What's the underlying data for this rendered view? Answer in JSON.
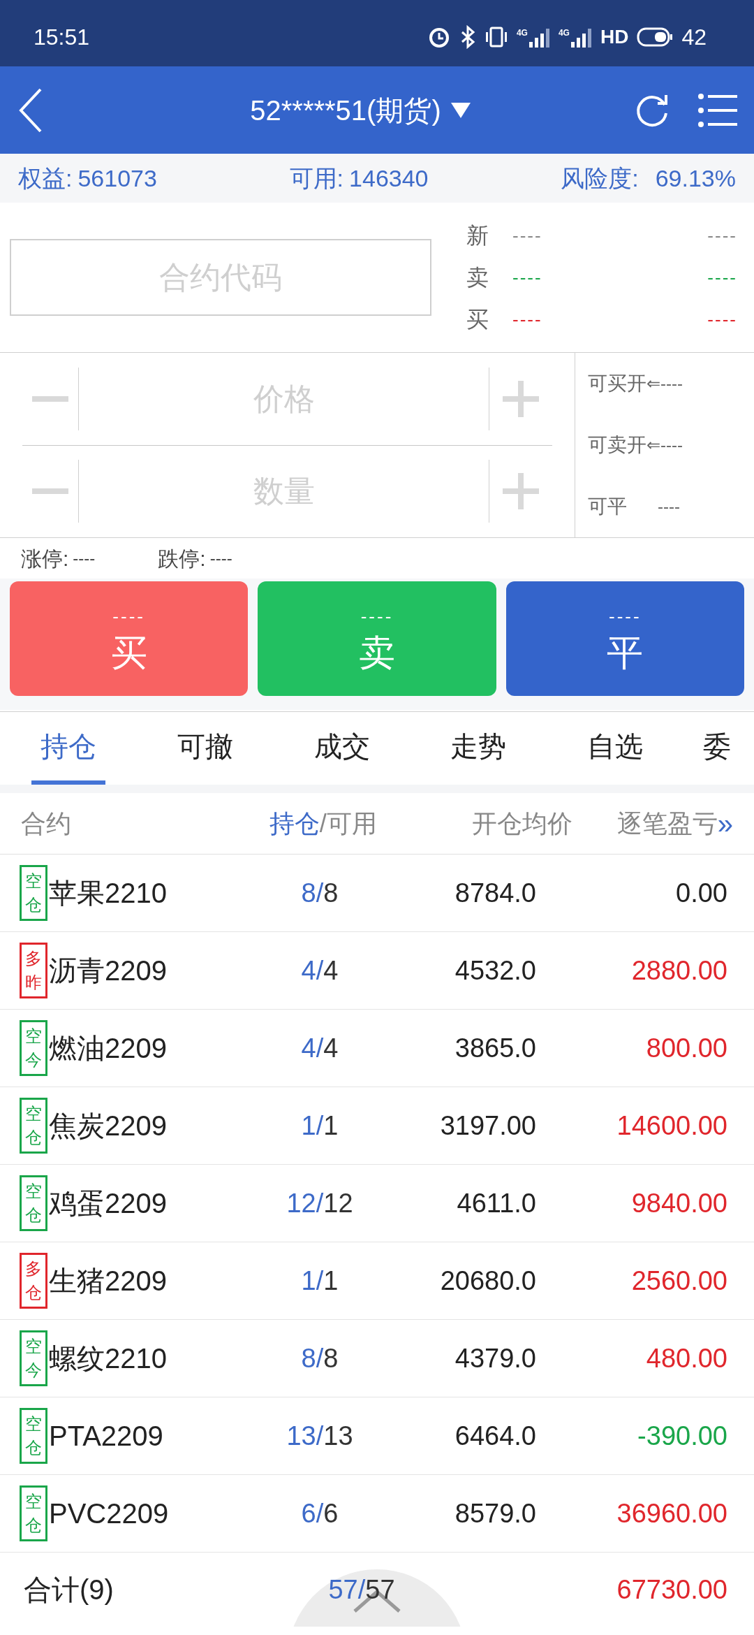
{
  "status_bar": {
    "time": "15:51",
    "network_labels": [
      "4G",
      "4G"
    ],
    "hd": "HD",
    "battery": "42"
  },
  "header": {
    "account": "52*****51(期货)"
  },
  "summary": [
    {
      "label": "权益:",
      "value": "561073"
    },
    {
      "label": "可用:",
      "value": "146340"
    },
    {
      "label": "风险度:",
      "value": "69.13%"
    }
  ],
  "contract_field": {
    "placeholder": "合约代码"
  },
  "quote": [
    {
      "label": "新",
      "left": "----",
      "right": "----",
      "color": "#888888"
    },
    {
      "label": "卖",
      "left": "----",
      "right": "----",
      "color": "#1aa64a"
    },
    {
      "label": "买",
      "left": "----",
      "right": "----",
      "color": "#e0262c"
    }
  ],
  "price_field": {
    "placeholder": "价格"
  },
  "quantity_field": {
    "placeholder": "数量"
  },
  "availability": [
    {
      "label": "可买开",
      "value": "⇐----"
    },
    {
      "label": "可卖开",
      "value": "⇐----"
    },
    {
      "label": "可平",
      "value": "----"
    }
  ],
  "limits": [
    {
      "label": "涨停:",
      "value": "----"
    },
    {
      "label": "跌停:",
      "value": "----"
    }
  ],
  "actions": [
    {
      "kind": "buy",
      "price": "----",
      "label": "买"
    },
    {
      "kind": "sell",
      "price": "----",
      "label": "卖"
    },
    {
      "kind": "close",
      "price": "----",
      "label": "平"
    }
  ],
  "tabs": [
    {
      "label": "持仓",
      "selected": true
    },
    {
      "label": "可撤",
      "selected": false
    },
    {
      "label": "成交",
      "selected": false
    },
    {
      "label": "走势",
      "selected": false
    },
    {
      "label": "自选",
      "selected": false
    },
    {
      "label": "委",
      "selected": false
    }
  ],
  "table": {
    "columns": {
      "contract": "合约",
      "held": "持仓",
      "available": "/可用",
      "avg_price": "开仓均价",
      "pnl": "逐笔盈亏",
      "more": "»"
    },
    "rows": [
      {
        "tag": [
          "空",
          "仓"
        ],
        "color": "#1aa64a",
        "name": "苹果2210",
        "held": "8/",
        "available": "8",
        "avg_price": "8784.0",
        "pnl": "0.00",
        "kind": "flat"
      },
      {
        "tag": [
          "多",
          "昨"
        ],
        "color": "#e0262c",
        "name": "沥青2209",
        "held": "4/",
        "available": "4",
        "avg_price": "4532.0",
        "pnl": "2880.00",
        "kind": "gain"
      },
      {
        "tag": [
          "空",
          "今"
        ],
        "color": "#1aa64a",
        "name": "燃油2209",
        "held": "4/",
        "available": "4",
        "avg_price": "3865.0",
        "pnl": "800.00",
        "kind": "gain"
      },
      {
        "tag": [
          "空",
          "仓"
        ],
        "color": "#1aa64a",
        "name": "焦炭2209",
        "held": "1/",
        "available": "1",
        "avg_price": "3197.00",
        "pnl": "14600.00",
        "kind": "gain"
      },
      {
        "tag": [
          "空",
          "仓"
        ],
        "color": "#1aa64a",
        "name": "鸡蛋2209",
        "held": "12/",
        "available": "12",
        "avg_price": "4611.0",
        "pnl": "9840.00",
        "kind": "gain"
      },
      {
        "tag": [
          "多",
          "仓"
        ],
        "color": "#e0262c",
        "name": "生猪2209",
        "held": "1/",
        "available": "1",
        "avg_price": "20680.0",
        "pnl": "2560.00",
        "kind": "gain"
      },
      {
        "tag": [
          "空",
          "今"
        ],
        "color": "#1aa64a",
        "name": "螺纹2210",
        "held": "8/",
        "available": "8",
        "avg_price": "4379.0",
        "pnl": "480.00",
        "kind": "gain"
      },
      {
        "tag": [
          "空",
          "仓"
        ],
        "color": "#1aa64a",
        "name": "PTA2209",
        "held": "13/",
        "available": "13",
        "avg_price": "6464.0",
        "pnl": "-390.00",
        "kind": "loss"
      },
      {
        "tag": [
          "空",
          "仓"
        ],
        "color": "#1aa64a",
        "name": "PVC2209",
        "held": "6/",
        "available": "6",
        "avg_price": "8579.0",
        "pnl": "36960.00",
        "kind": "gain"
      }
    ],
    "total": {
      "label": "合计(9)",
      "held": "57/",
      "available": "57",
      "pnl": "67730.00",
      "kind": "gain"
    }
  }
}
